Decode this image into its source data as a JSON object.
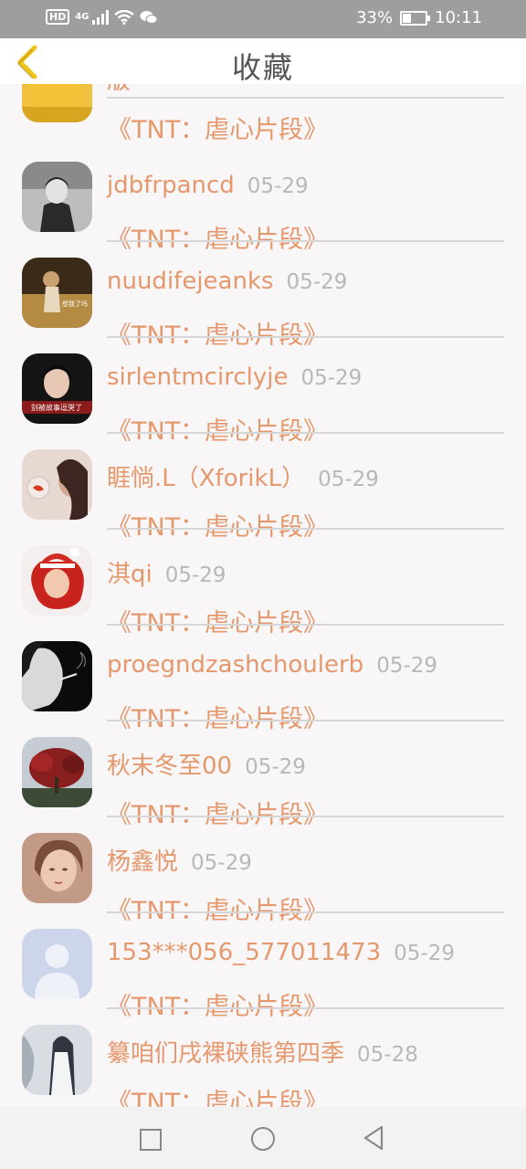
{
  "status_bar": {
    "hd": "HD",
    "network": "4G",
    "battery_percent": "33%",
    "battery_level": 0.33,
    "time": "10:11"
  },
  "header": {
    "title": "收藏"
  },
  "partial_item": {
    "name_fragment": "版",
    "movie": "《TNT：虐心片段》"
  },
  "items": [
    {
      "name": "jdbfrpancd",
      "date": "05-29",
      "movie": "《TNT：虐心片段》"
    },
    {
      "name": "nuudifejeanks",
      "date": "05-29",
      "movie": "《TNT：虐心片段》",
      "avatar_caption": "想我了吗"
    },
    {
      "name": "sirlentmcirclyje",
      "date": "05-29",
      "movie": "《TNT：虐心片段》",
      "avatar_caption": "别被故事逗哭了"
    },
    {
      "name": "睚惝.L（XforikL）",
      "date": "05-29",
      "movie": "《TNT：虐心片段》"
    },
    {
      "name": "淇qi",
      "date": "05-29",
      "movie": "《TNT：虐心片段》"
    },
    {
      "name": "proegndzashchoulerb",
      "date": "05-29",
      "movie": "《TNT：虐心片段》"
    },
    {
      "name": "秋末冬至00",
      "date": "05-29",
      "movie": "《TNT：虐心片段》"
    },
    {
      "name": "杨鑫悦",
      "date": "05-29",
      "movie": "《TNT：虐心片段》"
    },
    {
      "name": "153***056_577011473",
      "date": "05-29",
      "movie": "《TNT：虐心片段》"
    },
    {
      "name": "纂咱们戌裸硖熊第四季",
      "date": "05-28",
      "movie": "《TNT：虐心片段》"
    }
  ],
  "colors": {
    "accent": "#e6986d",
    "date": "#b8b8b8",
    "status_bar": "#9e9e9e",
    "back_arrow": "#f0c419"
  },
  "icons": {
    "back": "chevron-left-icon",
    "wifi": "wifi-icon",
    "wechat": "wechat-icon",
    "signal": "signal-icon",
    "battery": "battery-icon"
  }
}
